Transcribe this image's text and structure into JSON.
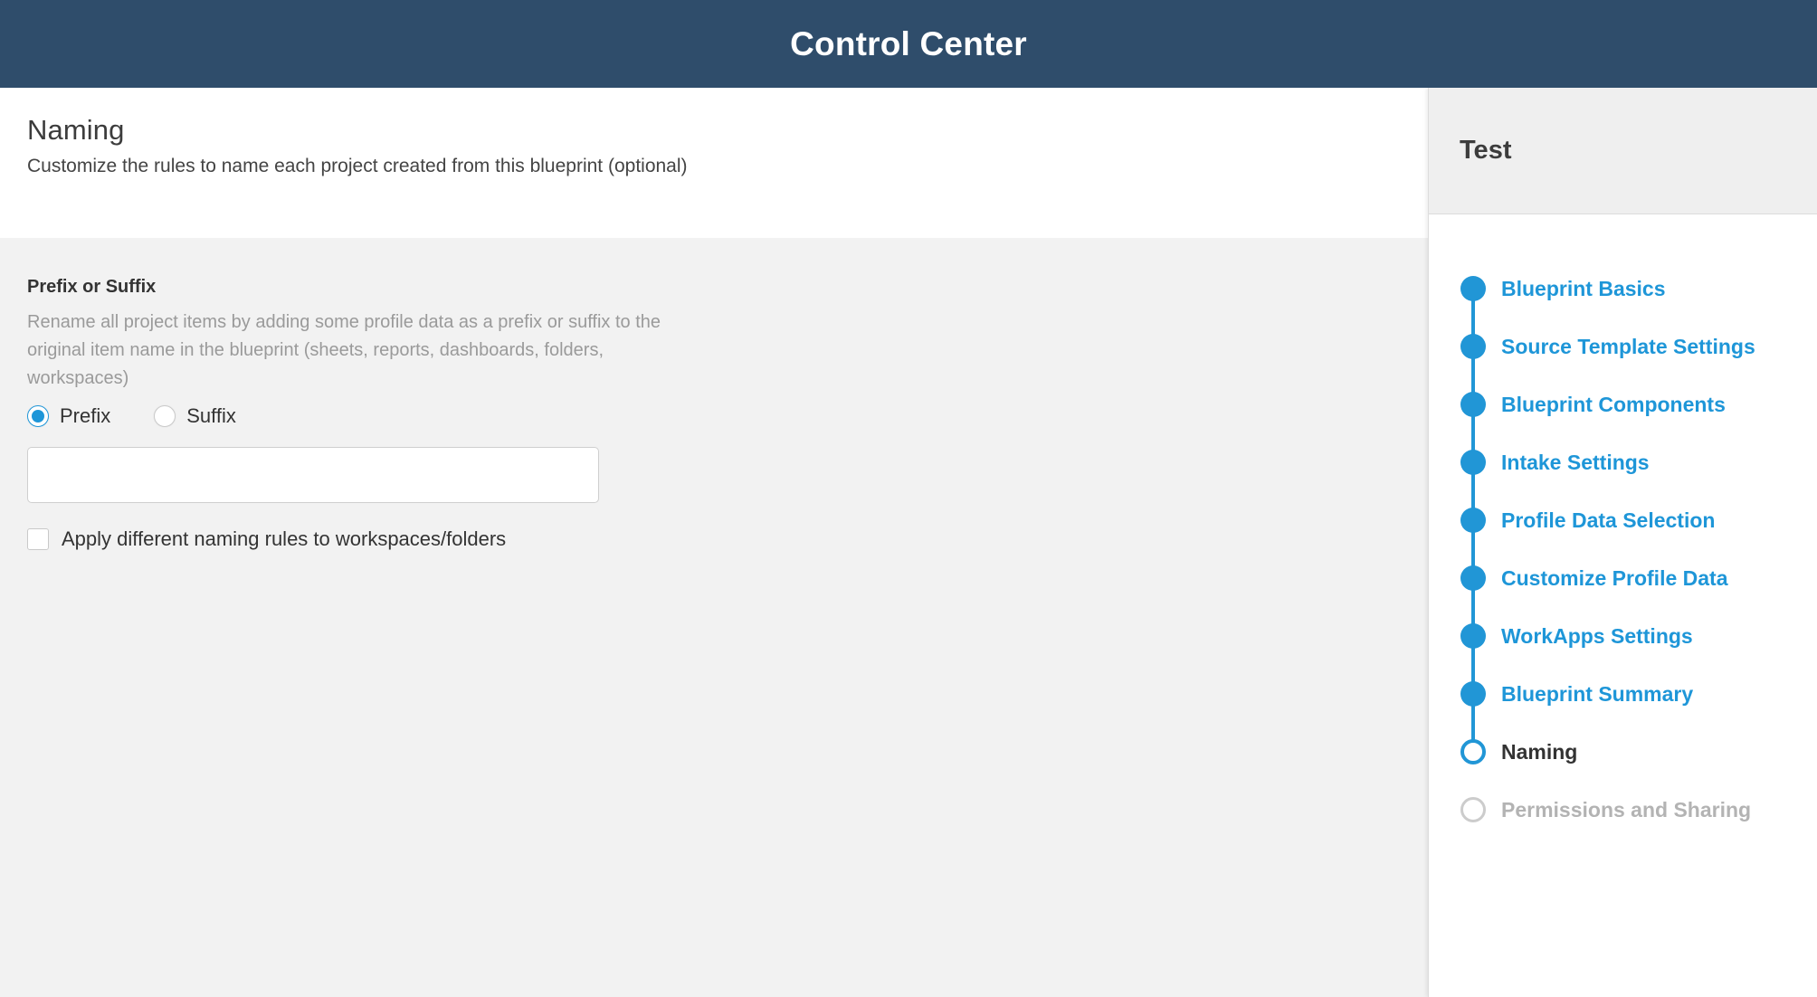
{
  "header": {
    "title": "Control Center",
    "bg_color": "#2F4D6B"
  },
  "page": {
    "title": "Naming",
    "subtitle": "Customize the rules to name each project created from this blueprint (optional)"
  },
  "form": {
    "section_label": "Prefix or Suffix",
    "section_description": "Rename all project items by adding some profile data as a prefix or suffix to the original item name in the blueprint (sheets, reports, dashboards, folders, workspaces)",
    "radios": [
      {
        "label": "Prefix",
        "selected": true
      },
      {
        "label": "Suffix",
        "selected": false
      }
    ],
    "text_input": {
      "value": "",
      "placeholder": ""
    },
    "checkbox": {
      "label": "Apply different naming rules to workspaces/folders",
      "checked": false
    }
  },
  "sidebar": {
    "title": "Test",
    "accent_color": "#2196d6",
    "steps": [
      {
        "label": "Blueprint Basics",
        "state": "done"
      },
      {
        "label": "Source Template Settings",
        "state": "done"
      },
      {
        "label": "Blueprint Components",
        "state": "done"
      },
      {
        "label": "Intake Settings",
        "state": "done"
      },
      {
        "label": "Profile Data Selection",
        "state": "done"
      },
      {
        "label": "Customize Profile Data",
        "state": "done"
      },
      {
        "label": "WorkApps Settings",
        "state": "done"
      },
      {
        "label": "Blueprint Summary",
        "state": "done"
      },
      {
        "label": "Naming",
        "state": "current"
      },
      {
        "label": "Permissions and Sharing",
        "state": "upcoming"
      }
    ]
  }
}
